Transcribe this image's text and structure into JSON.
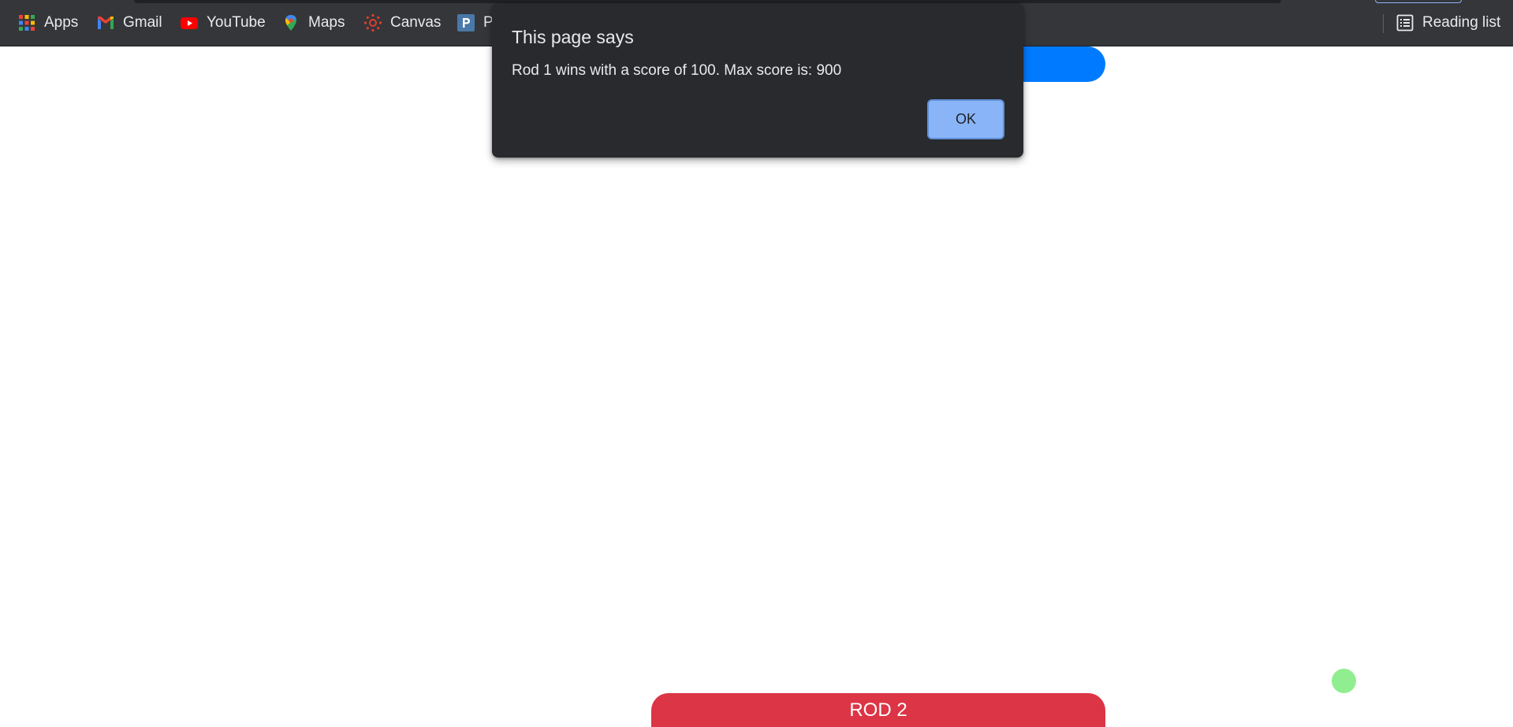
{
  "bookmarks": {
    "items": [
      {
        "label": "Apps",
        "icon": "apps-grid-icon"
      },
      {
        "label": "Gmail",
        "icon": "gmail-icon"
      },
      {
        "label": "YouTube",
        "icon": "youtube-icon"
      },
      {
        "label": "Maps",
        "icon": "maps-pin-icon"
      },
      {
        "label": "Canvas",
        "icon": "canvas-icon"
      },
      {
        "label": "P",
        "icon": "bookmark-p-icon"
      }
    ],
    "reading_list": "Reading list"
  },
  "game": {
    "rod1_label": "",
    "rod2_label": "ROD 2"
  },
  "dialog": {
    "title": "This page says",
    "message": "Rod 1 wins with a score of 100. Max score is: 900",
    "ok_label": "OK"
  },
  "colors": {
    "bookmarks_bar": "#35363a",
    "rod1": "#007bff",
    "rod2": "#dc3545",
    "ball": "#90ee90",
    "dialog_bg": "#292a2d",
    "ok_button": "#8ab4f8"
  }
}
